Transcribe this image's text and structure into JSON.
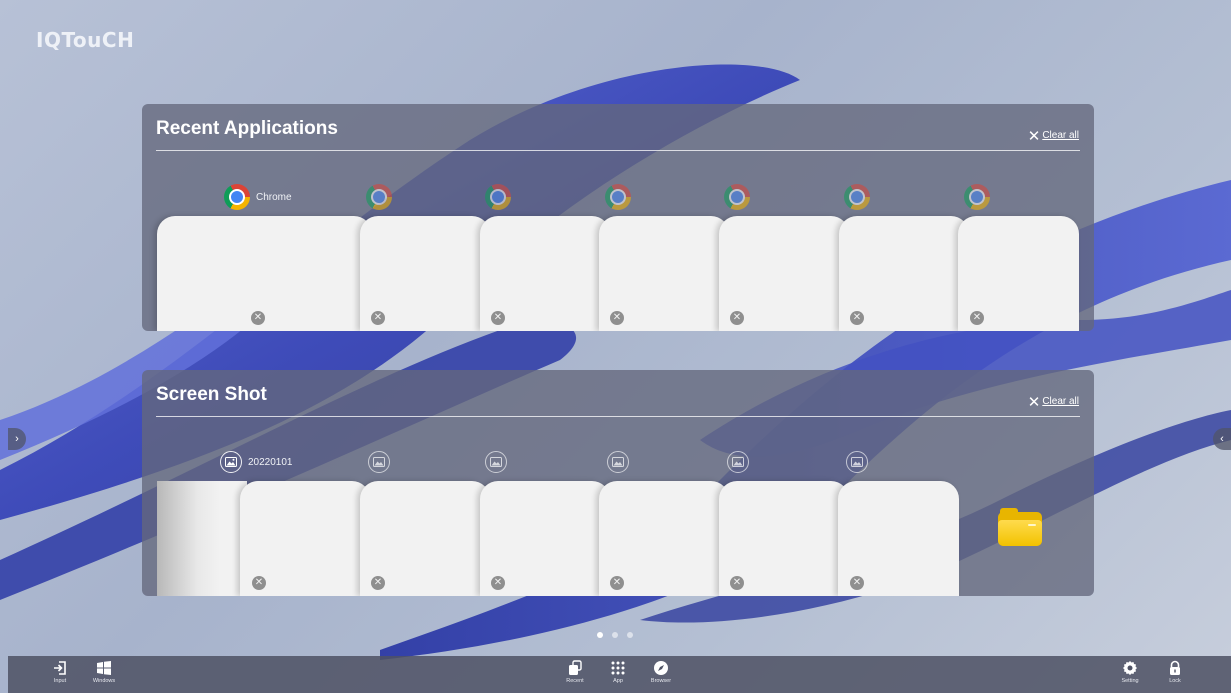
{
  "brand": "IQTouCH",
  "recent_apps": {
    "title": "Recent Applications",
    "clear_all": "Clear all",
    "first_app_label": "Chrome",
    "card_count": 7
  },
  "screen_shot": {
    "title": "Screen Shot",
    "clear_all": "Clear all",
    "first_label": "20220101",
    "card_count": 6
  },
  "pager": {
    "pages": 3,
    "active": 1
  },
  "taskbar": {
    "input": "Input",
    "windows": "Windows",
    "recent": "Recent",
    "app": "App",
    "browser": "Browser",
    "setting": "Setting",
    "lock": "Lock"
  },
  "icons": {
    "chrome": "chrome-icon",
    "screenshot": "image-icon",
    "close": "close-icon",
    "folder": "folder-icon"
  }
}
